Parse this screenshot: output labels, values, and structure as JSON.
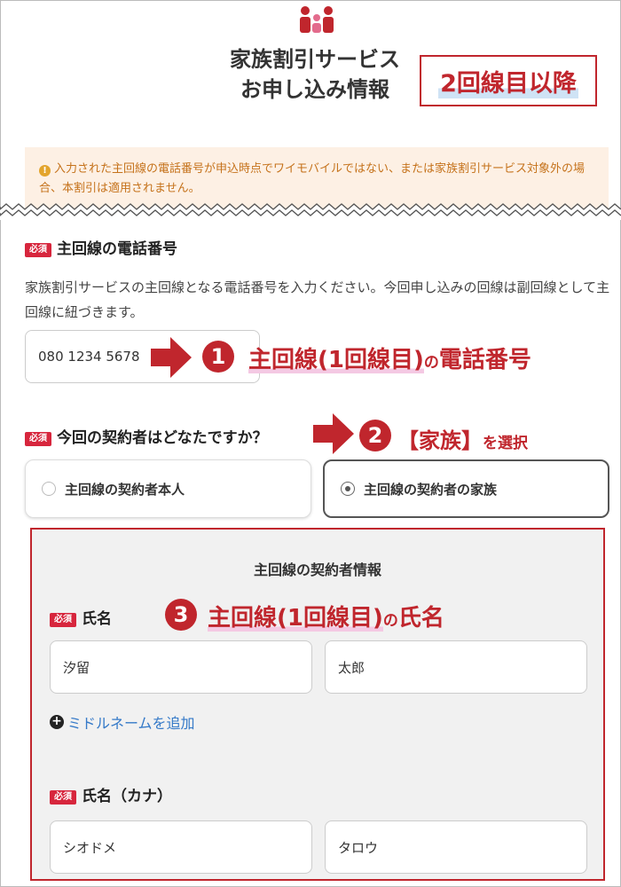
{
  "header": {
    "title_line1": "家族割引サービス",
    "title_line2": "お申し込み情報",
    "stamp_text": "2回線目以降",
    "logo_icon": "family-icon"
  },
  "notice": {
    "icon": "info-icon",
    "icon_glyph": "!",
    "text": "入力された主回線の電話番号が申込時点でワイモバイルではない、または家族割引サービス対象外の場合、本割引は適用されません。"
  },
  "required_badge": "必須",
  "phone": {
    "label": "主回線の電話番号",
    "description": "家族割引サービスの主回線となる電話番号を入力ください。今回申し込みの回線は副回線として主回線に紐づきます。",
    "value": "080 1234 5678"
  },
  "annotations": {
    "step1": {
      "num": "1",
      "main": "主回線(1回線目)",
      "small": "の",
      "tail": "電話番号"
    },
    "step2": {
      "num": "2",
      "main": "【家族】",
      "small": "を選択"
    },
    "step3": {
      "num": "3",
      "main": "主回線(1回線目)",
      "small": "の",
      "tail": "氏名"
    }
  },
  "contractor": {
    "question": "今回の契約者はどなたですか？",
    "options": [
      {
        "label": "主回線の契約者本人",
        "selected": false
      },
      {
        "label": "主回線の契約者の家族",
        "selected": true
      }
    ]
  },
  "holder_info": {
    "title": "主回線の契約者情報",
    "name_label": "氏名",
    "last_name": "汐留",
    "first_name": "太郎",
    "add_middle_name": "ミドルネームを追加",
    "kana_label": "氏名（カナ）",
    "last_name_kana": "シオドメ",
    "first_name_kana": "タロウ"
  },
  "colors": {
    "accent_red": "#c0262d",
    "badge_red": "#d7263d",
    "notice_bg": "#fdf0e4",
    "notice_text": "#c5721b",
    "link_blue": "#3479c8"
  }
}
